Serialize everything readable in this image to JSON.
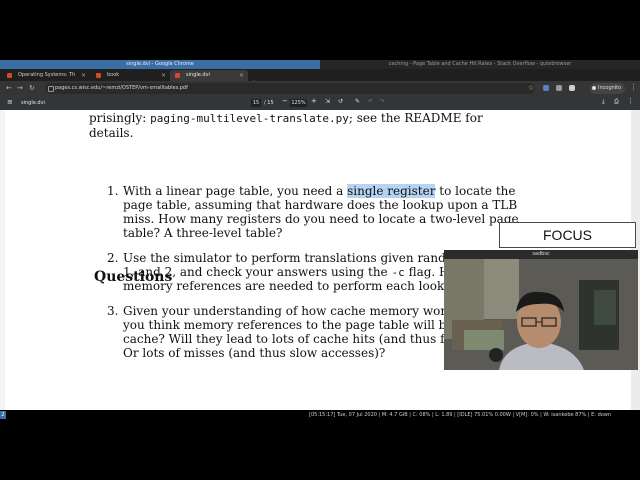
{
  "window": {
    "left_title": "single.dvi - Google Chrome",
    "right_title": "caching - Page Table and Cache Hit Rates - Stack Overflow - qutebrowser"
  },
  "tabs": [
    {
      "label": "Operating Systems: Th"
    },
    {
      "label": "book"
    },
    {
      "label": "single.dvi"
    }
  ],
  "address": {
    "url": "pages.cs.wisc.edu/~remzi/OSTEP/vm-smalltables.pdf",
    "incognito_label": "Incognito"
  },
  "pdf": {
    "filename": "single.dvi",
    "page_current": "15",
    "page_total": "/ 15",
    "zoom": "125%"
  },
  "document": {
    "intro_line1_pre": "prisingly:",
    "intro_line1_code": "paging-multilevel-translate.py",
    "intro_line1_post": "; see the README for",
    "intro_line2": "details.",
    "section_title": "Questions",
    "q1_num": "1.",
    "q1_l1_pre": "With a linear page table, you need a",
    "q1_l1_hl": "single register",
    "q1_l1_post": "to locate the",
    "q1_l2": "page table, assuming that hardware does the lookup upon a TLB",
    "q1_l3": "miss.  How many registers do you need to locate a two-level page",
    "q1_l4": "table? A three-level table?",
    "q2_num": "2.",
    "q2_l1": "Use the simulator to perform translations given random seeds 0,",
    "q2_l2_pre": "1, and 2, and check your answers using the",
    "q2_l2_code": "-c",
    "q2_l2_post": "flag.  How many",
    "q2_l3": "memory references are needed to perform each lookup?",
    "q3_num": "3.",
    "q3_l1": "Given your understanding of how cache memory works, how do",
    "q3_l2": "you think memory references to the page table will behave in the",
    "q3_l3": "cache? Will they lead to lots of cache hits (and thus fast accesses?)",
    "q3_l4": "Or lots of misses (and thus slow accesses)?"
  },
  "statusbar": {
    "workspace": "2",
    "text": "[05:15:17] Tue, 07 Jul 2020  |  M: 4.7 GiB  |  C: 08%  |  L: 1.89  |  [IDLE] 75.01% 0.00W  |  V[M]: 0%  |  W: isankebe  87%  |  E: down"
  },
  "overlay": {
    "focus_label": "FOCUS",
    "camera_title": "sadbsc"
  },
  "colors": {
    "title_left": "#3b6ea5",
    "highlight": "#b4d4f2",
    "pdf_toolbar": "#323639"
  }
}
